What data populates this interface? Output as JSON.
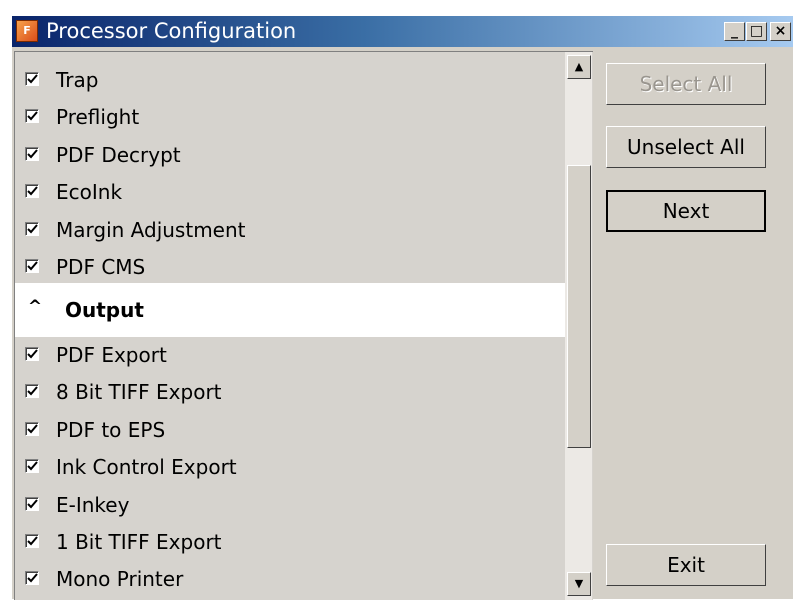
{
  "window": {
    "title": "Processor Configuration",
    "controls": {
      "minimize": "_",
      "maximize": "□",
      "close": "×"
    }
  },
  "list": {
    "items_before": [
      {
        "label": "Trap",
        "checked": true
      },
      {
        "label": "Preflight",
        "checked": true
      },
      {
        "label": "PDF Decrypt",
        "checked": true
      },
      {
        "label": "EcoInk",
        "checked": true
      },
      {
        "label": "Margin Adjustment",
        "checked": true
      },
      {
        "label": "PDF CMS",
        "checked": true
      }
    ],
    "group": {
      "label": "Output",
      "caret": "^"
    },
    "items_after": [
      {
        "label": "PDF Export",
        "checked": true
      },
      {
        "label": "8 Bit TIFF Export",
        "checked": true
      },
      {
        "label": "PDF to EPS",
        "checked": true
      },
      {
        "label": "Ink Control Export",
        "checked": true
      },
      {
        "label": "E-Inkey",
        "checked": true
      },
      {
        "label": "1 Bit TIFF Export",
        "checked": true
      },
      {
        "label": "Mono Printer",
        "checked": true
      }
    ]
  },
  "buttons": {
    "select_all": "Select All",
    "unselect_all": "Unselect All",
    "next": "Next",
    "exit": "Exit"
  },
  "icons": {
    "app": "app-logo-icon",
    "check": "checkmark-icon",
    "caret": "chevron-up-icon",
    "scroll_up": "scroll-up-arrow-icon",
    "scroll_down": "scroll-down-arrow-icon"
  }
}
